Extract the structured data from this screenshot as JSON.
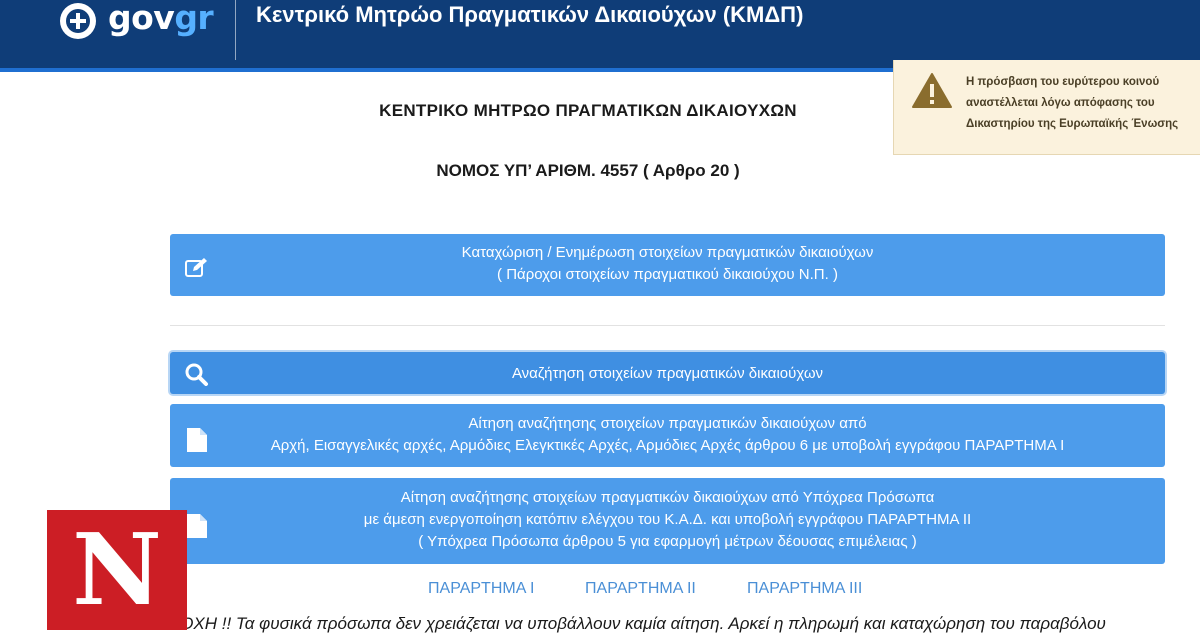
{
  "header": {
    "logo_gov": "gov",
    "logo_gr": "gr",
    "title": "Κεντρικό Μητρώο Πραγματικών Δικαιούχων (ΚΜΔΠ)"
  },
  "notice": {
    "lines": [
      "Η πρόσβαση του ευρύτερου κοινού",
      "αναστέλλεται λόγω απόφασης του",
      "Δικαστηρίου της Ευρωπαϊκής Ένωσης"
    ]
  },
  "page": {
    "heading": "ΚΕΝΤΡΙΚΟ ΜΗΤΡΩΟ ΠΡΑΓΜΑΤΙΚΩΝ ΔΙΚΑΙΟΥΧΩΝ",
    "subheading": "ΝΟΜΟΣ ΥΠ’ ΑΡΙΘΜ. 4557 ( Αρθρο 20 )"
  },
  "actions": [
    {
      "icon": "edit-icon",
      "lines": [
        "Καταχώριση / Ενημέρωση στοιχείων πραγματικών δικαιούχων",
        "( Πάροχοι στοιχείων πραγματικού δικαιούχου Ν.Π. )"
      ]
    },
    {
      "icon": "search-icon",
      "lines": [
        "Αναζήτηση στοιχείων πραγματικών δικαιούχων"
      ]
    },
    {
      "icon": "document-icon",
      "lines": [
        "Αίτηση αναζήτησης στοιχείων πραγματικών δικαιούχων από",
        "Αρχή, Εισαγγελικές αρχές, Αρμόδιες Ελεγκτικές Αρχές, Αρμόδιες Αρχές άρθρου 6 με υποβολή εγγράφου ΠΑΡΑΡΤΗΜΑ Ι"
      ]
    },
    {
      "icon": "document-icon",
      "lines": [
        "Αίτηση αναζήτησης στοιχείων πραγματικών δικαιούχων από Υπόχρεα Πρόσωπα",
        "με άμεση ενεργοποίηση κατόπιν ελέγχου του Κ.Α.Δ. και υποβολή εγγράφου ΠΑΡΑΡΤΗΜΑ ΙΙ",
        "( Υπόχρεα Πρόσωπα άρθρου 5 για εφαρμογή μέτρων δέουσας επιμέλειας )"
      ]
    }
  ],
  "annexes": [
    "ΠΑΡΑΡΤΗΜΑ Ι",
    "ΠΑΡΑΡΤΗΜΑ ΙΙ",
    "ΠΑΡΑΡΤΗΜΑ ΙΙΙ"
  ],
  "note": "ΣΟΧΗ !! Τα φυσικά πρόσωπα δεν χρειάζεται να υποβάλλουν καμία αίτηση. Αρκεί η πληρωμή και καταχώρηση του παραβόλου",
  "watermark": {
    "letter": "N"
  },
  "colors": {
    "header_bg": "#0f3d78",
    "header_accent": "#1f6fd1",
    "button_bg": "#4d9ceb",
    "link": "#4a8fd6",
    "notice_bg": "#fbf2dd",
    "watermark_bg": "#cc1e25"
  }
}
